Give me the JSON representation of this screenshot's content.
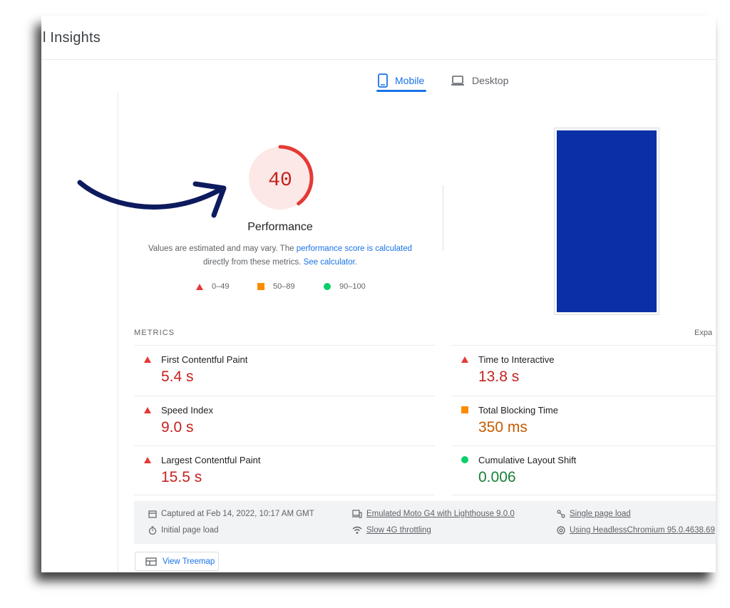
{
  "header": {
    "title": "l Insights"
  },
  "tabs": [
    {
      "label": "Mobile",
      "icon": "phone-icon",
      "active": true
    },
    {
      "label": "Desktop",
      "icon": "laptop-icon",
      "active": false
    }
  ],
  "score": {
    "value": "40",
    "fraction": 0.4,
    "label": "Performance",
    "color": "#e53935",
    "bg": "#fce8e6"
  },
  "description": {
    "text1": "Values are estimated and may vary. The ",
    "link1": "performance score is calculated",
    "text2": "directly from these metrics. ",
    "link2": "See calculator",
    "text3": "."
  },
  "legend": [
    {
      "range": "0–49",
      "shape": "triangle",
      "color": "#e53935"
    },
    {
      "range": "50–89",
      "shape": "square",
      "color": "#fb8c00"
    },
    {
      "range": "90–100",
      "shape": "circle",
      "color": "#0cce6b"
    }
  ],
  "metrics": {
    "heading": "METRICS",
    "expand_label": "Expa",
    "items": [
      {
        "name": "First Contentful Paint",
        "value": "5.4 s",
        "rating": "fail"
      },
      {
        "name": "Time to Interactive",
        "value": "13.8 s",
        "rating": "fail"
      },
      {
        "name": "Speed Index",
        "value": "9.0 s",
        "rating": "fail"
      },
      {
        "name": "Total Blocking Time",
        "value": "350 ms",
        "rating": "average"
      },
      {
        "name": "Largest Contentful Paint",
        "value": "15.5 s",
        "rating": "fail"
      },
      {
        "name": "Cumulative Layout Shift",
        "value": "0.006",
        "rating": "pass"
      }
    ]
  },
  "run_info": {
    "captured": "Captured at Feb 14, 2022, 10:17 AM GMT",
    "initial": "Initial page load",
    "device": "Emulated Moto G4 with Lighthouse 9.0.0",
    "throttling": "Slow 4G throttling",
    "single": "Single page load",
    "browser": "Using HeadlessChromium 95.0.4638.69"
  },
  "treemap_button": "View Treemap",
  "colors": {
    "accent": "#1a73e8",
    "fail": "#c5221f",
    "average": "#c45a00",
    "pass": "#188038",
    "arrow": "#0d1b5e"
  }
}
